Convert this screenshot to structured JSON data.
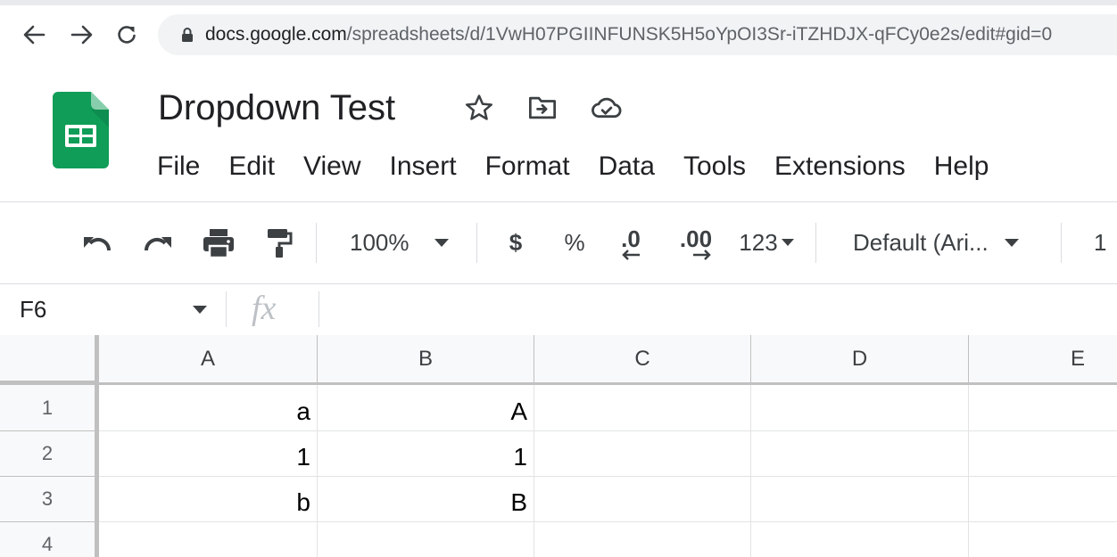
{
  "browser": {
    "url_host": "docs.google.com",
    "url_path": "/spreadsheets/d/1VwH07PGIINFUNSK5H5oYpOI3Sr-iTZHDJX-qFCy0e2s/edit#gid=0",
    "icons": [
      "back-arrow-icon",
      "forward-arrow-icon",
      "reload-icon",
      "lock-icon"
    ]
  },
  "doc": {
    "title": "Dropdown Test",
    "title_icons": [
      "star-icon",
      "move-to-folder-icon",
      "cloud-status-icon"
    ],
    "logo": "google-sheets-logo"
  },
  "menu": [
    "File",
    "Edit",
    "View",
    "Insert",
    "Format",
    "Data",
    "Tools",
    "Extensions",
    "Help"
  ],
  "toolbar": {
    "zoom": "100%",
    "currency": "$",
    "percent": "%",
    "decrease_decimal": ".0",
    "increase_decimal": ".00",
    "number_format": "123",
    "font": "Default (Ari...",
    "font_size_partial": "1",
    "icons": [
      "undo-icon",
      "redo-icon",
      "print-icon",
      "paint-format-icon"
    ]
  },
  "formula_bar": {
    "name_box": "F6",
    "fx": "fx",
    "formula": ""
  },
  "grid": {
    "columns": [
      "A",
      "B",
      "C",
      "D",
      "E"
    ],
    "rows": [
      {
        "num": "1",
        "cells": [
          "a",
          "A",
          "",
          "",
          ""
        ]
      },
      {
        "num": "2",
        "cells": [
          "1",
          "1",
          "",
          "",
          ""
        ]
      },
      {
        "num": "3",
        "cells": [
          "b",
          "B",
          "",
          "",
          ""
        ]
      },
      {
        "num": "4",
        "cells": [
          "",
          "",
          "",
          "",
          ""
        ]
      }
    ]
  },
  "colors": {
    "sheets_green": "#0F9D58",
    "sheets_green_dark": "#188038",
    "header_bg": "#f8f9fa",
    "grid_line": "#e2e3e3"
  }
}
